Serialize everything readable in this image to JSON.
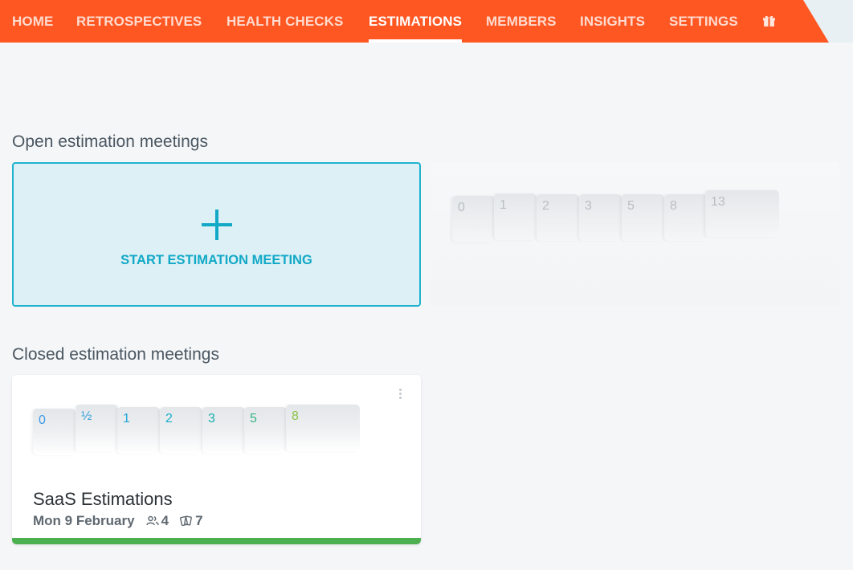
{
  "nav": {
    "items": [
      {
        "label": "HOME",
        "active": false
      },
      {
        "label": "RETROSPECTIVES",
        "active": false
      },
      {
        "label": "HEALTH CHECKS",
        "active": false
      },
      {
        "label": "ESTIMATIONS",
        "active": true
      },
      {
        "label": "MEMBERS",
        "active": false
      },
      {
        "label": "INSIGHTS",
        "active": false
      },
      {
        "label": "SETTINGS",
        "active": false
      }
    ],
    "gift_icon": "gift-icon",
    "color": "#ff5722"
  },
  "open_section": {
    "title": "Open estimation meetings",
    "start_card": {
      "label": "START ESTIMATION MEETING",
      "icon": "plus-icon"
    },
    "placeholder_deck": [
      "0",
      "1",
      "2",
      "3",
      "5",
      "8",
      "13"
    ]
  },
  "closed_section": {
    "title": "Closed estimation meetings",
    "meeting": {
      "deck": [
        "0",
        "½",
        "1",
        "2",
        "3",
        "5",
        "8"
      ],
      "deck_colors": [
        "#3f9ae6",
        "#2f9ed8",
        "#23a8d8",
        "#1bb0cc",
        "#1aafaf",
        "#36b383",
        "#8bc34a"
      ],
      "title": "SaaS Estimations",
      "date": "Mon 9 February",
      "participants": "4",
      "cards": "7",
      "progress": 1.0,
      "progress_color": "#4caf50"
    }
  }
}
